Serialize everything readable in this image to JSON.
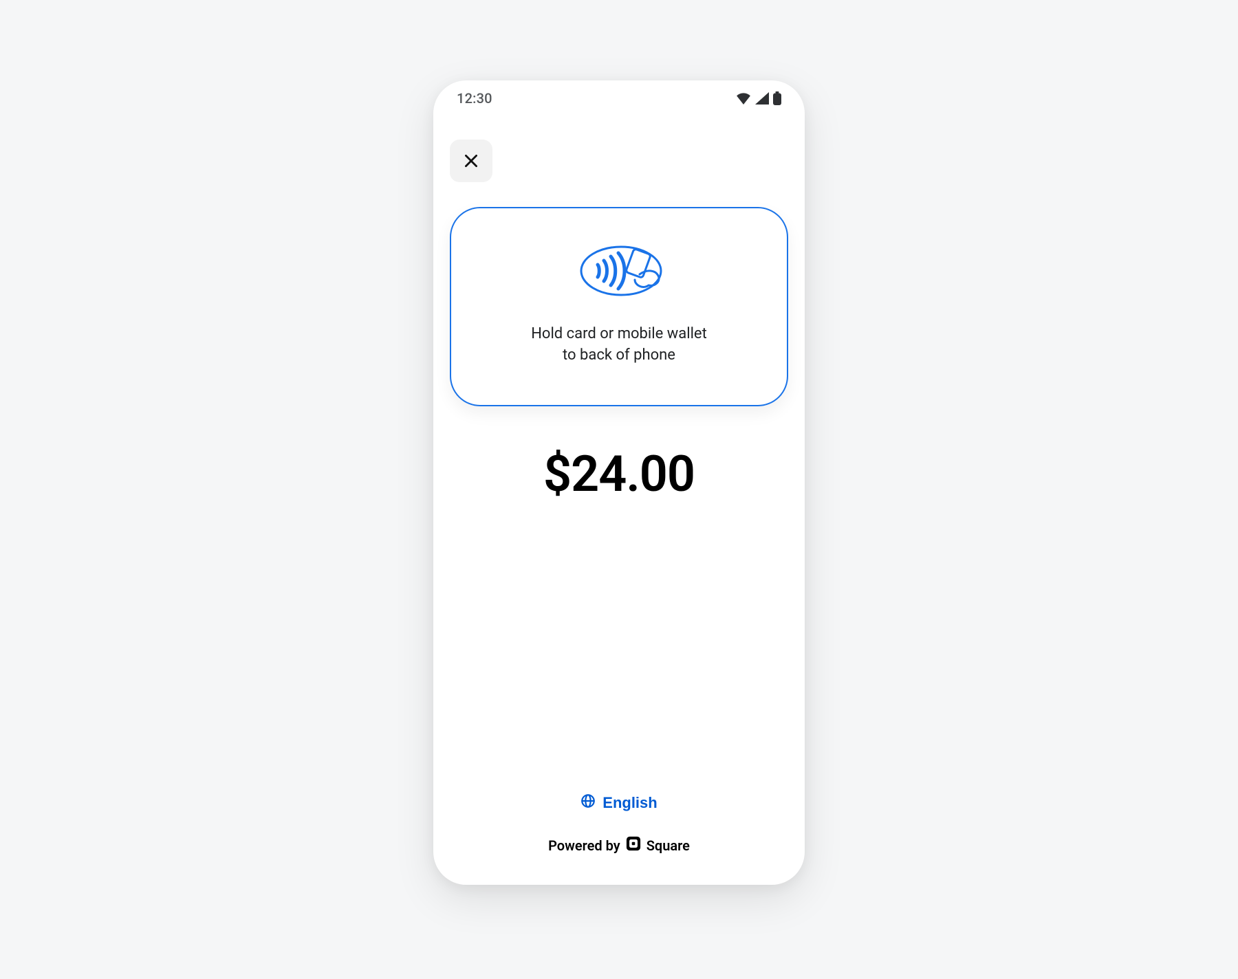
{
  "status": {
    "time": "12:30"
  },
  "tap_panel": {
    "line1": "Hold card or mobile wallet",
    "line2": "to back of phone"
  },
  "amount": "$24.00",
  "language": {
    "label": "English"
  },
  "powered": {
    "prefix": "Powered by",
    "brand": "Square"
  },
  "colors": {
    "accent": "#1a73e8",
    "link": "#005bd3"
  }
}
